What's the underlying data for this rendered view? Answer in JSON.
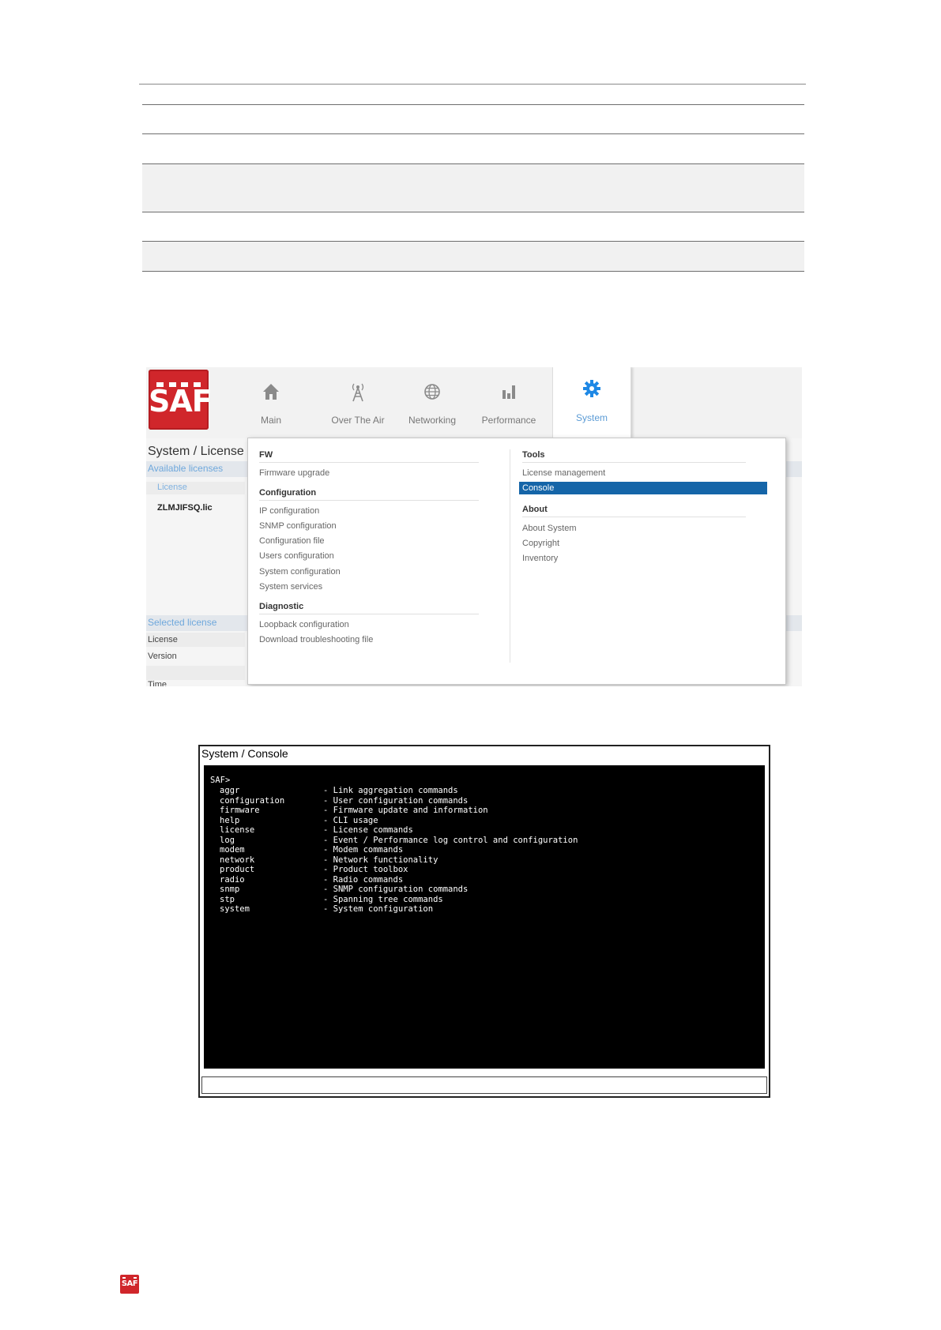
{
  "ui": {
    "logo_text": "SAF",
    "nav": [
      {
        "label": "Main",
        "icon": "home-icon"
      },
      {
        "label": "Over The Air",
        "icon": "antenna-icon"
      },
      {
        "label": "Networking",
        "icon": "globe-icon"
      },
      {
        "label": "Performance",
        "icon": "bar-chart-icon"
      },
      {
        "label": "System",
        "icon": "gear-icon",
        "active": true
      }
    ],
    "page_title": "System / License",
    "available_licenses": {
      "label": "Available licenses",
      "column": "License",
      "file": "ZLMJIFSQ.lic"
    },
    "selected_license": {
      "label": "Selected license",
      "fields": [
        "License",
        "Version",
        "Time"
      ]
    },
    "menu": {
      "fw": {
        "header": "FW",
        "items": [
          "Firmware upgrade"
        ]
      },
      "configuration": {
        "header": "Configuration",
        "items": [
          "IP configuration",
          "SNMP configuration",
          "Configuration file",
          "Users configuration",
          "System configuration",
          "System services"
        ]
      },
      "diagnostic": {
        "header": "Diagnostic",
        "items": [
          "Loopback configuration",
          "Download troubleshooting file"
        ]
      },
      "tools": {
        "header": "Tools",
        "items": [
          "License management",
          "Console"
        ],
        "selected": "Console"
      },
      "about": {
        "header": "About",
        "items": [
          "About System",
          "Copyright",
          "Inventory"
        ]
      }
    },
    "accent_color": "#1565a8",
    "logo_color": "#d0262b"
  },
  "console": {
    "title": "System / Console",
    "prompt": "SAF>",
    "commands": [
      {
        "cmd": "aggr",
        "desc": "- Link aggregation commands"
      },
      {
        "cmd": "configuration",
        "desc": "- User configuration commands"
      },
      {
        "cmd": "firmware",
        "desc": "- Firmware update and information"
      },
      {
        "cmd": "help",
        "desc": "- CLI usage"
      },
      {
        "cmd": "license",
        "desc": "- License commands"
      },
      {
        "cmd": "log",
        "desc": "- Event / Performance log control and configuration"
      },
      {
        "cmd": "modem",
        "desc": "- Modem commands"
      },
      {
        "cmd": "network",
        "desc": "- Network functionality"
      },
      {
        "cmd": "product",
        "desc": "- Product toolbox"
      },
      {
        "cmd": "radio",
        "desc": "- Radio commands"
      },
      {
        "cmd": "snmp",
        "desc": "- SNMP configuration commands"
      },
      {
        "cmd": "stp",
        "desc": "- Spanning tree commands"
      },
      {
        "cmd": "system",
        "desc": "- System configuration"
      }
    ]
  },
  "footer": {
    "logo_text": "SAF"
  }
}
